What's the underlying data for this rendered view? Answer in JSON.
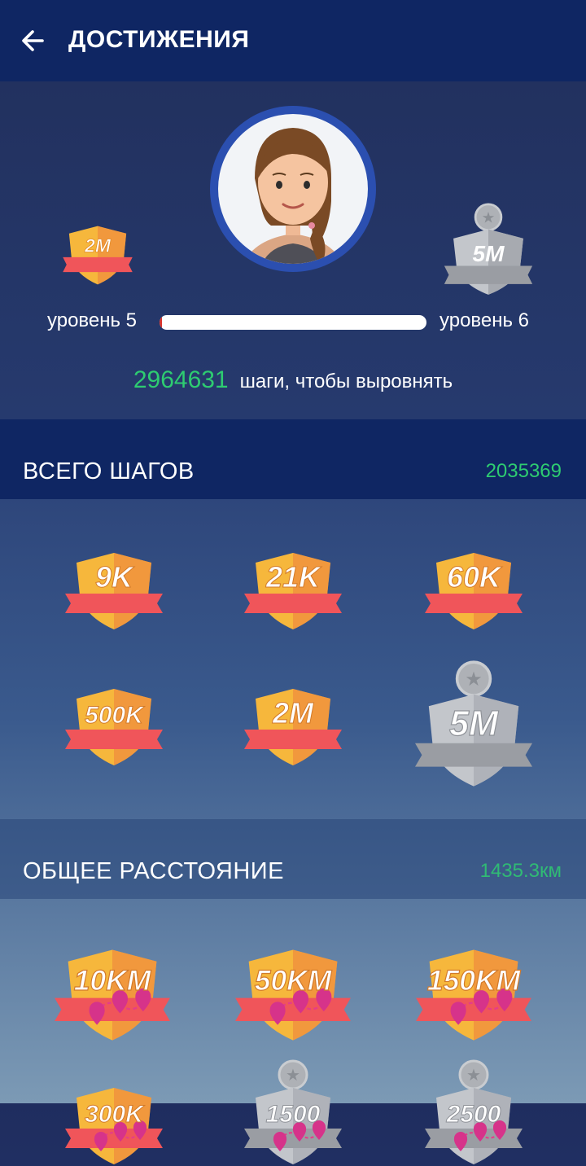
{
  "header": {
    "title": "ДОСТИЖЕНИЯ",
    "back_icon": "arrow-left-icon"
  },
  "profile": {
    "avatar_icon": "girl-avatar-icon",
    "current_badge": "2M",
    "next_badge": "5M",
    "current_level": "уровень 5",
    "next_level": "уровень 6",
    "progress": 0.01,
    "steps_to_level": "2964631",
    "steps_to_level_text": "шаги, чтобы выровнять"
  },
  "total_steps": {
    "title": "ВСЕГО ШАГОВ",
    "value": "2035369",
    "badges": [
      {
        "label": "9K",
        "achieved": true
      },
      {
        "label": "21K",
        "achieved": true
      },
      {
        "label": "60K",
        "achieved": true
      },
      {
        "label": "500K",
        "achieved": true
      },
      {
        "label": "2M",
        "achieved": true
      },
      {
        "label": "5M",
        "achieved": false
      }
    ]
  },
  "total_distance": {
    "title": "ОБЩЕЕ РАССТОЯНИЕ",
    "value": "1435.3км",
    "badges": [
      {
        "label": "10KM",
        "achieved": true
      },
      {
        "label": "50KM",
        "achieved": true
      },
      {
        "label": "150KM",
        "achieved": true
      },
      {
        "label": "300K",
        "achieved": true
      },
      {
        "label": "1500",
        "achieved": false
      },
      {
        "label": "2500",
        "achieved": false
      }
    ]
  },
  "colors": {
    "accent_green": "#2ecc71",
    "appbar": "#0f2663",
    "medal_gold": "#f6b73c",
    "ribbon_red": "#f0555a",
    "locked_gray": "#b9bcc2"
  }
}
